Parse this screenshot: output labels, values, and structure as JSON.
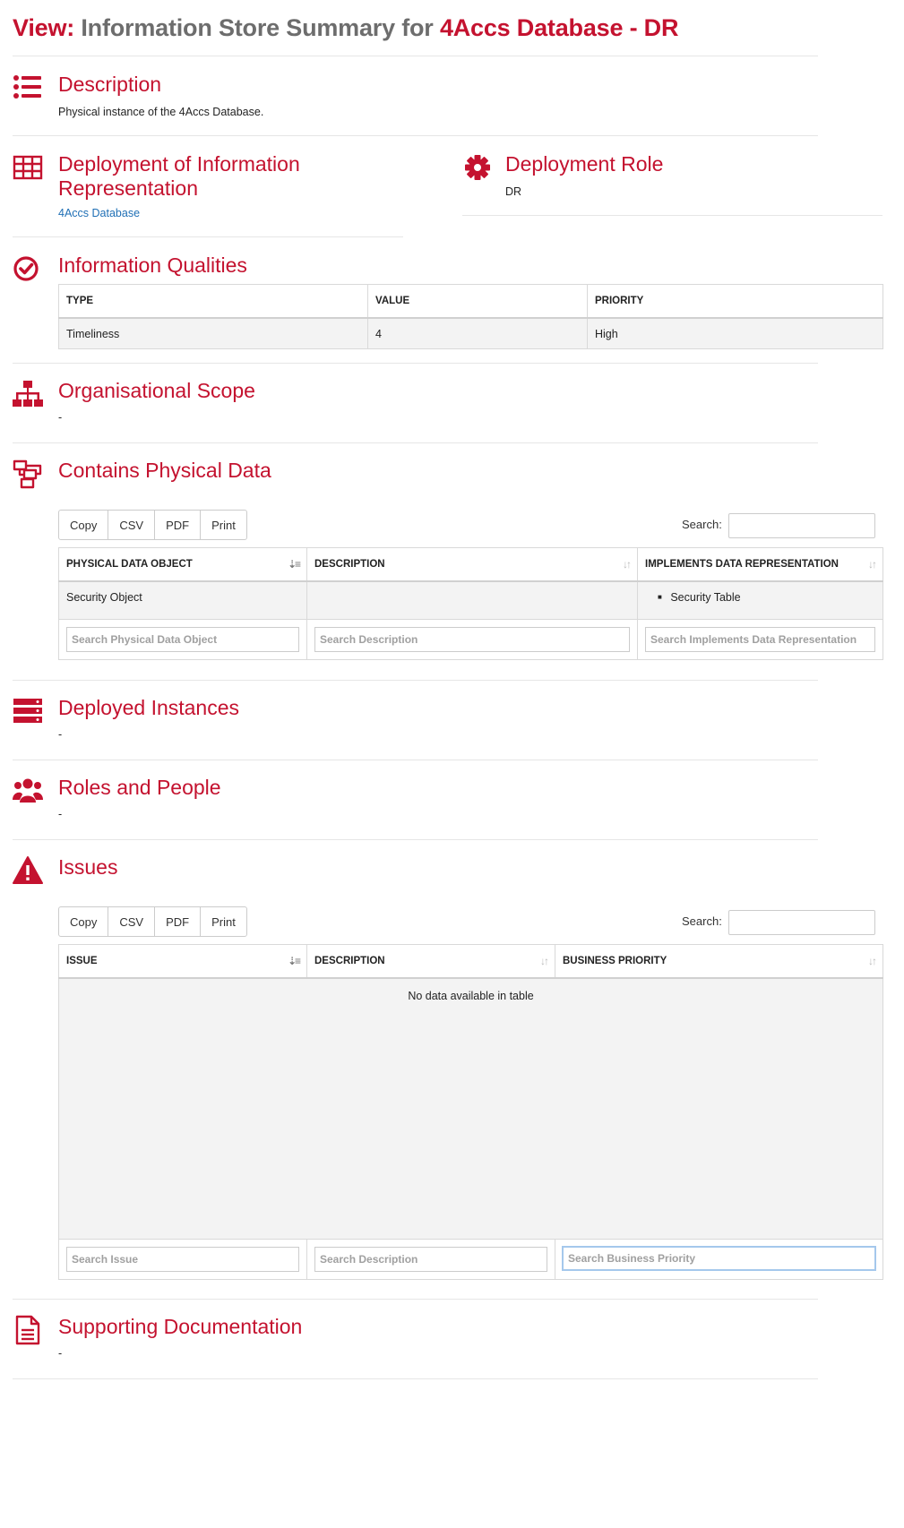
{
  "header": {
    "prefix": "View:",
    "middle": "Information Store Summary for",
    "subject": "4Accs Database - DR"
  },
  "description": {
    "title": "Description",
    "text": "Physical instance of the 4Accs Database.",
    "icon": "list-icon"
  },
  "deployment_info": {
    "title_line1": "Deployment of Information",
    "title_line2": "Representation",
    "link": "4Accs Database",
    "icon": "table-grid-icon"
  },
  "deployment_role": {
    "title": "Deployment Role",
    "value": "DR",
    "icon": "gear-icon"
  },
  "qualities": {
    "title": "Information Qualities",
    "icon": "check-circle-icon",
    "headers": [
      "TYPE",
      "VALUE",
      "PRIORITY"
    ],
    "rows": [
      [
        "Timeliness",
        "4",
        "High"
      ]
    ]
  },
  "org_scope": {
    "title": "Organisational Scope",
    "value": "-",
    "icon": "org-chart-icon"
  },
  "physical_data": {
    "title": "Contains Physical Data",
    "icon": "physical-data-icon",
    "buttons": [
      "Copy",
      "CSV",
      "PDF",
      "Print"
    ],
    "search_label": "Search:",
    "headers": [
      "PHYSICAL DATA OBJECT",
      "DESCRIPTION",
      "IMPLEMENTS DATA REPRESENTATION"
    ],
    "rows": [
      {
        "object": "Security Object",
        "description": "",
        "implements": [
          "Security Table"
        ]
      }
    ],
    "filters": [
      "Search Physical Data Object",
      "Search Description",
      "Search Implements Data Representation"
    ]
  },
  "deployed_instances": {
    "title": "Deployed Instances",
    "value": "-",
    "icon": "server-icon"
  },
  "roles_people": {
    "title": "Roles and People",
    "value": "-",
    "icon": "users-icon"
  },
  "issues": {
    "title": "Issues",
    "icon": "warning-icon",
    "buttons": [
      "Copy",
      "CSV",
      "PDF",
      "Print"
    ],
    "search_label": "Search:",
    "headers": [
      "ISSUE",
      "DESCRIPTION",
      "BUSINESS PRIORITY"
    ],
    "empty_text": "No data available in table",
    "filters": [
      "Search Issue",
      "Search Description",
      "Search Business Priority"
    ]
  },
  "supporting_docs": {
    "title": "Supporting Documentation",
    "value": "-",
    "icon": "document-icon"
  },
  "colors": {
    "accent": "#c4122f",
    "link": "#1f6fb5",
    "heading_grey": "#6d6d6d"
  }
}
